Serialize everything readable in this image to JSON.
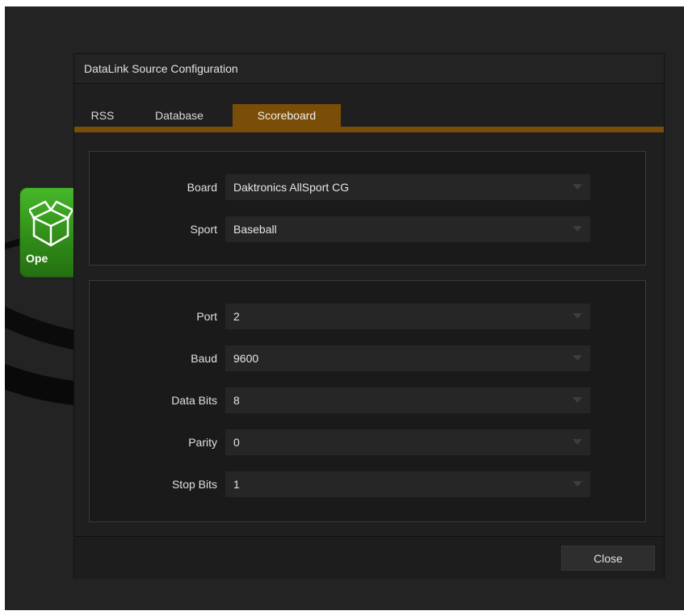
{
  "dialog": {
    "title": "DataLink Source Configuration",
    "close_label": "Close"
  },
  "tabs": [
    {
      "label": "RSS"
    },
    {
      "label": "Database"
    },
    {
      "label": "Scoreboard",
      "active": true
    }
  ],
  "source_group": {
    "board": {
      "label": "Board",
      "value": "Daktronics AllSport CG"
    },
    "sport": {
      "label": "Sport",
      "value": "Baseball"
    }
  },
  "serial_group": {
    "port": {
      "label": "Port",
      "value": "2"
    },
    "baud": {
      "label": "Baud",
      "value": "9600"
    },
    "data_bits": {
      "label": "Data Bits",
      "value": "8"
    },
    "parity": {
      "label": "Parity",
      "value": "0"
    },
    "stop_bits": {
      "label": "Stop Bits",
      "value": "1"
    }
  },
  "background": {
    "tile_label": "Ope",
    "tile_icon": "open-box-icon"
  },
  "colors": {
    "accent": "#7a4e08",
    "tile_green": "#3aa020"
  }
}
